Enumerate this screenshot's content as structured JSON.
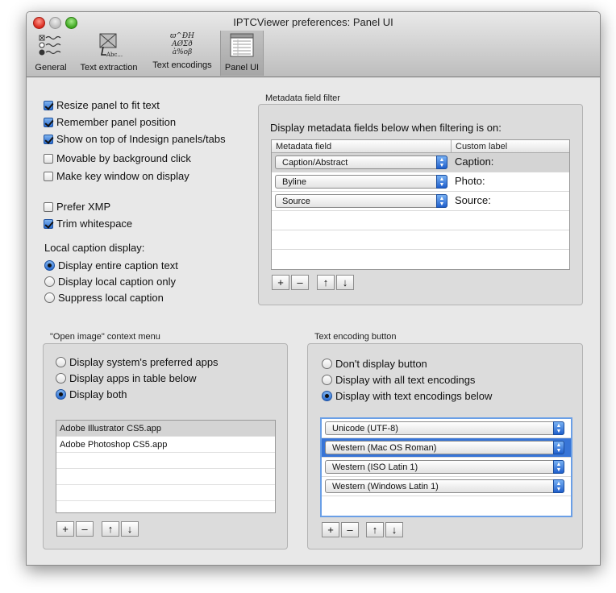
{
  "window": {
    "title": "IPTCViewer preferences: Panel UI"
  },
  "toolbar": {
    "items": [
      {
        "label": "General"
      },
      {
        "label": "Text extraction"
      },
      {
        "label": "Text encodings"
      },
      {
        "label": "Panel UI"
      }
    ],
    "text_encodings_glyphs": [
      "ϖ^ÐH",
      "AØΣð",
      "à%oβ"
    ],
    "text_extraction_glyph": "Abc..."
  },
  "options": {
    "resize_panel": "Resize panel to fit text",
    "remember_position": "Remember panel position",
    "show_on_top": "Show on top of Indesign panels/tabs",
    "movable_bg": "Movable by background click",
    "make_key": "Make key window on display",
    "prefer_xmp": "Prefer XMP",
    "trim_whitespace": "Trim whitespace"
  },
  "local_caption": {
    "title": "Local caption display:",
    "options": [
      "Display entire caption text",
      "Display local caption only",
      "Suppress local caption"
    ]
  },
  "metadata_filter": {
    "title": "Metadata field filter",
    "description": "Display metadata fields below when filtering is on:",
    "col_field": "Metadata field",
    "col_label": "Custom label",
    "rows": [
      {
        "field": "Caption/Abstract",
        "label": "Caption:"
      },
      {
        "field": "Byline",
        "label": "Photo:"
      },
      {
        "field": "Source",
        "label": "Source:"
      }
    ]
  },
  "open_image": {
    "title": "\"Open image\" context menu",
    "options": [
      "Display system's preferred apps",
      "Display apps in table below",
      "Display both"
    ],
    "apps": [
      "Adobe Illustrator CS5.app",
      "Adobe Photoshop CS5.app"
    ]
  },
  "text_encoding_button": {
    "title": "Text encoding button",
    "options": [
      "Don't display button",
      "Display with all text encodings",
      "Display with text encodings below"
    ],
    "encodings": [
      "Unicode (UTF-8)",
      "Western (Mac OS Roman)",
      "Western (ISO Latin 1)",
      "Western (Windows Latin 1)"
    ]
  },
  "buttons": {
    "add": "+",
    "remove": "–",
    "up": "↑",
    "down": "↓"
  }
}
